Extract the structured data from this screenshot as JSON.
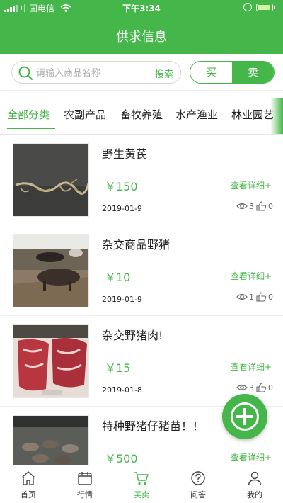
{
  "status_bar": {
    "carrier": "中国电信",
    "time": "下午3:34",
    "battery_level": 0.85
  },
  "header": {
    "title": "供求信息"
  },
  "search": {
    "placeholder": "请输入商品名称",
    "button_label": "搜索"
  },
  "mode_toggle": {
    "buy_label": "买",
    "sell_label": "卖",
    "selected": "卖"
  },
  "categories": {
    "selected": "全部分类",
    "items": [
      "全部分类",
      "农副产品",
      "畜牧养殖",
      "水产渔业",
      "林业园艺"
    ]
  },
  "listings": [
    {
      "title": "野生黄芪",
      "price": "￥150",
      "detail_label": "查看详细+",
      "date": "2019-01-9",
      "views": "3",
      "likes": "0"
    },
    {
      "title": "杂交商品野猪",
      "price": "￥10",
      "detail_label": "查看详细+",
      "date": "2019-01-9",
      "views": "1",
      "likes": "0"
    },
    {
      "title": "杂交野猪肉!",
      "price": "￥15",
      "detail_label": "查看详细+",
      "date": "2019-01-8",
      "views": "3",
      "likes": "0"
    },
    {
      "title": "特种野猪仔猪苗！！",
      "price": "￥500",
      "detail_label": "查看详细+"
    }
  ],
  "fab": {
    "icon": "plus-icon"
  },
  "bottom_nav": {
    "selected": "买卖",
    "items": [
      {
        "label": "首页",
        "icon": "home-icon"
      },
      {
        "label": "行情",
        "icon": "calendar-icon"
      },
      {
        "label": "买卖",
        "icon": "cart-icon"
      },
      {
        "label": "问答",
        "icon": "question-icon"
      },
      {
        "label": "我的",
        "icon": "user-icon"
      }
    ]
  },
  "colors": {
    "brand_green": "#45b649",
    "text": "#222222",
    "muted": "#666666"
  }
}
